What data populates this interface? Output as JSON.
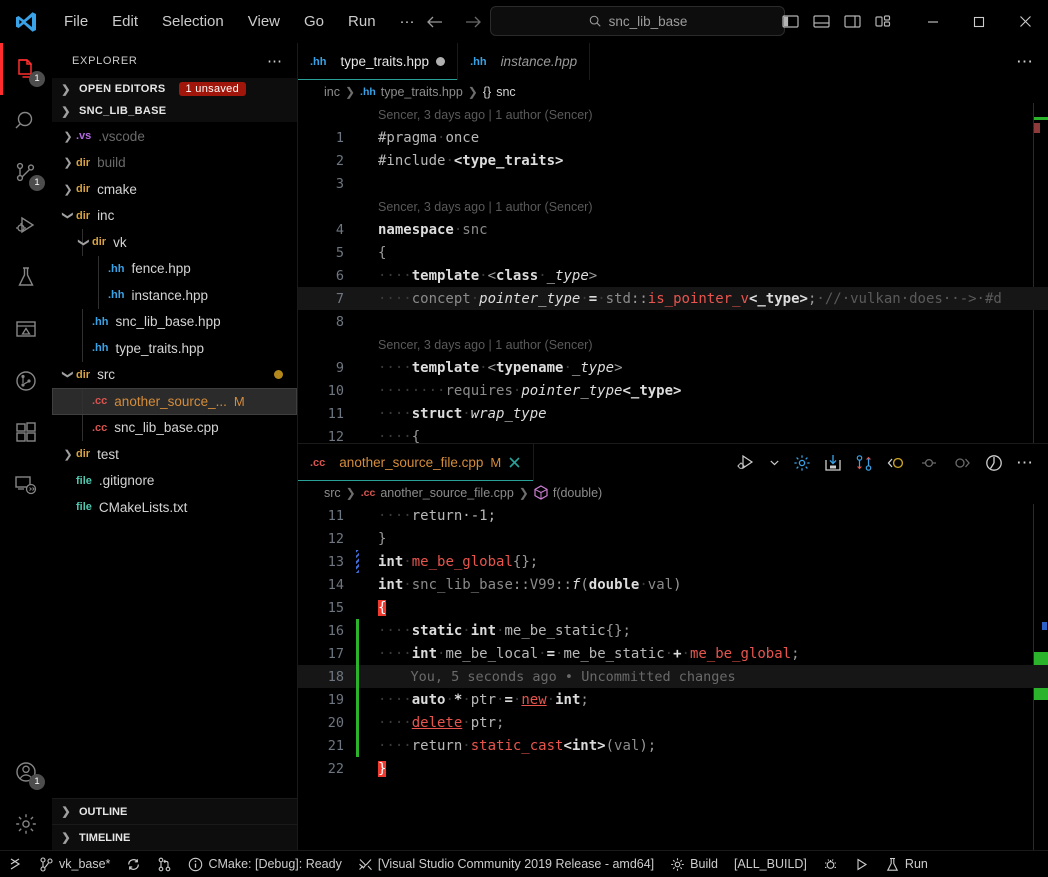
{
  "titlebar": {
    "logo": "vscode-logo-icon",
    "menus": [
      "File",
      "Edit",
      "Selection",
      "View",
      "Go",
      "Run",
      "···"
    ],
    "back_icon": "arrow-left-icon",
    "forward_icon": "arrow-right-icon",
    "search": {
      "icon": "search-icon",
      "value": "snc_lib_base",
      "placeholder": "Search"
    },
    "layout_icons": [
      "toggle-primary-sidebar-icon",
      "toggle-panel-icon",
      "toggle-secondary-sidebar-icon",
      "customize-layout-icon"
    ],
    "window_controls": [
      "minimize-icon",
      "maximize-icon",
      "close-icon"
    ]
  },
  "activitybar": {
    "items": [
      {
        "name": "explorer",
        "icon": "files-icon",
        "badge": "1",
        "active": true
      },
      {
        "name": "search",
        "icon": "search-icon",
        "badge": "",
        "active": false
      },
      {
        "name": "source-control",
        "icon": "source-control-icon",
        "badge": "1",
        "active": false
      },
      {
        "name": "run-and-debug",
        "icon": "run-debug-icon",
        "badge": "",
        "active": false
      },
      {
        "name": "testing",
        "icon": "beaker-icon",
        "badge": "",
        "active": false
      },
      {
        "name": "cmake",
        "icon": "cmake-icon",
        "badge": "",
        "active": false
      },
      {
        "name": "git-graph",
        "icon": "git-graph-icon",
        "badge": "",
        "active": false
      },
      {
        "name": "extensions",
        "icon": "extensions-icon",
        "badge": "",
        "active": false
      },
      {
        "name": "remote-explorer",
        "icon": "remote-icon",
        "badge": "",
        "active": false
      }
    ],
    "bottom_items": [
      {
        "name": "accounts",
        "icon": "account-icon",
        "badge": "1"
      },
      {
        "name": "manage-settings",
        "icon": "gear-icon",
        "badge": ""
      }
    ]
  },
  "sidebar": {
    "title": "EXPLORER",
    "more_icon": "more-actions-icon",
    "open_editors": {
      "label": "OPEN EDITORS",
      "badge": "1 unsaved",
      "expanded": false
    },
    "workspace": {
      "label": "SNC_LIB_BASE",
      "expanded": true
    },
    "tree": [
      {
        "indent": 1,
        "arrow": "collapsed",
        "icon": ".vs",
        "icon_color": "#b36ae2",
        "label": ".vscode",
        "label_color": "#6a6a6a",
        "modified": "",
        "dot": false
      },
      {
        "indent": 1,
        "arrow": "collapsed",
        "icon": "dir",
        "icon_color": "#d9a441",
        "label": "build",
        "label_color": "#6a6a6a",
        "modified": "",
        "dot": false
      },
      {
        "indent": 1,
        "arrow": "collapsed",
        "icon": "dir",
        "icon_color": "#d9a441",
        "label": "cmake",
        "label_color": "#d4d4d4",
        "modified": "",
        "dot": false
      },
      {
        "indent": 1,
        "arrow": "expanded",
        "icon": "dir",
        "icon_color": "#d9a441",
        "label": "inc",
        "label_color": "#d4d4d4",
        "modified": "",
        "dot": false
      },
      {
        "indent": 2,
        "arrow": "expanded",
        "icon": "dir",
        "icon_color": "#d9a441",
        "label": "vk",
        "label_color": "#d4d4d4",
        "modified": "",
        "dot": false
      },
      {
        "indent": 3,
        "arrow": "none",
        "icon": ".hh",
        "icon_color": "#3aa3e8",
        "label": "fence.hpp",
        "label_color": "#d4d4d4",
        "modified": "",
        "dot": false
      },
      {
        "indent": 3,
        "arrow": "none",
        "icon": ".hh",
        "icon_color": "#3aa3e8",
        "label": "instance.hpp",
        "label_color": "#d4d4d4",
        "modified": "",
        "dot": false
      },
      {
        "indent": 2,
        "arrow": "none",
        "icon": ".hh",
        "icon_color": "#3aa3e8",
        "label": "snc_lib_base.hpp",
        "label_color": "#d4d4d4",
        "modified": "",
        "dot": false
      },
      {
        "indent": 2,
        "arrow": "none",
        "icon": ".hh",
        "icon_color": "#3aa3e8",
        "label": "type_traits.hpp",
        "label_color": "#d4d4d4",
        "modified": "",
        "dot": false
      },
      {
        "indent": 1,
        "arrow": "expanded",
        "icon": "dir",
        "icon_color": "#d9a441",
        "label": "src",
        "label_color": "#d4d4d4",
        "modified": "",
        "dot": true
      },
      {
        "indent": 2,
        "arrow": "none",
        "icon": ".cc",
        "icon_color": "#d9534f",
        "label": "another_source_...",
        "label_color": "#d48c3a",
        "modified": "M",
        "dot": false,
        "selected": true
      },
      {
        "indent": 2,
        "arrow": "none",
        "icon": ".cc",
        "icon_color": "#d9534f",
        "label": "snc_lib_base.cpp",
        "label_color": "#d4d4d4",
        "modified": "",
        "dot": false
      },
      {
        "indent": 1,
        "arrow": "collapsed",
        "icon": "dir",
        "icon_color": "#d9a441",
        "label": "test",
        "label_color": "#d4d4d4",
        "modified": "",
        "dot": false
      },
      {
        "indent": 1,
        "arrow": "none",
        "icon": "file",
        "icon_color": "#4ec9b0",
        "label": ".gitignore",
        "label_color": "#d4d4d4",
        "modified": "",
        "dot": false
      },
      {
        "indent": 1,
        "arrow": "none",
        "icon": "file",
        "icon_color": "#4ec9b0",
        "label": "CMakeLists.txt",
        "label_color": "#d4d4d4",
        "modified": "",
        "dot": false
      }
    ],
    "outline": "OUTLINE",
    "timeline": "TIMELINE"
  },
  "editor_top": {
    "tabs": [
      {
        "icon": ".hh",
        "icon_color": "#3aa3e8",
        "label": "type_traits.hpp",
        "active": true,
        "dirty": true,
        "italic": false
      },
      {
        "icon": ".hh",
        "icon_color": "#3aa3e8",
        "label": "instance.hpp",
        "active": false,
        "dirty": false,
        "italic": true
      }
    ],
    "more_icon": "editor-actions-more-icon",
    "breadcrumb": [
      {
        "text": "inc",
        "kind": "folder"
      },
      {
        "text": ".hh",
        "kind": "hh-badge"
      },
      {
        "text": "type_traits.hpp",
        "kind": "file"
      },
      {
        "text": "{}",
        "kind": "namespace-icon"
      },
      {
        "text": "snc",
        "kind": "symbol"
      }
    ],
    "lines": [
      {
        "no": "",
        "kind": "blame",
        "text": "Sencer, 3 days ago | 1 author (Sencer)"
      },
      {
        "no": "1",
        "kind": "code",
        "tokens": [
          {
            "t": "#pragma",
            "c": "plain"
          },
          {
            "t": "·",
            "c": "ind"
          },
          {
            "t": "once",
            "c": "plain"
          }
        ]
      },
      {
        "no": "2",
        "kind": "code",
        "tokens": [
          {
            "t": "#include",
            "c": "plain"
          },
          {
            "t": "·",
            "c": "ind"
          },
          {
            "t": "<type_traits>",
            "c": "kw"
          }
        ]
      },
      {
        "no": "3",
        "kind": "code",
        "tokens": []
      },
      {
        "no": "",
        "kind": "blame",
        "text": "Sencer, 3 days ago | 1 author (Sencer)"
      },
      {
        "no": "4",
        "kind": "code",
        "tokens": [
          {
            "t": "namespace",
            "c": "kw"
          },
          {
            "t": "·",
            "c": "ind"
          },
          {
            "t": "snc",
            "c": "dim"
          }
        ]
      },
      {
        "no": "5",
        "kind": "code",
        "tokens": [
          {
            "t": "{",
            "c": "punct"
          }
        ]
      },
      {
        "no": "6",
        "kind": "code",
        "tokens": [
          {
            "t": "····",
            "c": "ind"
          },
          {
            "t": "template",
            "c": "kw"
          },
          {
            "t": "·",
            "c": "ind"
          },
          {
            "t": "<",
            "c": "punct"
          },
          {
            "t": "class",
            "c": "kw"
          },
          {
            "t": "·",
            "c": "ind"
          },
          {
            "t": "_type",
            "c": "type-i"
          },
          {
            "t": ">",
            "c": "punct"
          }
        ]
      },
      {
        "no": "7",
        "kind": "code",
        "highlight": true,
        "tokens": [
          {
            "t": "····",
            "c": "ind"
          },
          {
            "t": "concept",
            "c": "dim"
          },
          {
            "t": "·",
            "c": "ind"
          },
          {
            "t": "pointer_type",
            "c": "type-i"
          },
          {
            "t": "·",
            "c": "ind"
          },
          {
            "t": "=",
            "c": "kw"
          },
          {
            "t": "·",
            "c": "ind"
          },
          {
            "t": "std",
            "c": "dim"
          },
          {
            "t": "::",
            "c": "punct"
          },
          {
            "t": "is_pointer_v",
            "c": "id-red"
          },
          {
            "t": "<_type>",
            "c": "kw"
          },
          {
            "t": ";",
            "c": "punct"
          },
          {
            "t": "·//·vulkan·does··->·#d",
            "c": "comment"
          }
        ]
      },
      {
        "no": "8",
        "kind": "code",
        "tokens": []
      },
      {
        "no": "",
        "kind": "blame",
        "text": "Sencer, 3 days ago | 1 author (Sencer)"
      },
      {
        "no": "9",
        "kind": "code",
        "tokens": [
          {
            "t": "····",
            "c": "ind"
          },
          {
            "t": "template",
            "c": "kw"
          },
          {
            "t": "·",
            "c": "ind"
          },
          {
            "t": "<",
            "c": "punct"
          },
          {
            "t": "typename",
            "c": "kw"
          },
          {
            "t": "·",
            "c": "ind"
          },
          {
            "t": "_type",
            "c": "type-i"
          },
          {
            "t": ">",
            "c": "punct"
          }
        ]
      },
      {
        "no": "10",
        "kind": "code",
        "tokens": [
          {
            "t": "········",
            "c": "ind"
          },
          {
            "t": "requires",
            "c": "dim"
          },
          {
            "t": "·",
            "c": "ind"
          },
          {
            "t": "pointer_type",
            "c": "type-i"
          },
          {
            "t": "<_type>",
            "c": "kw"
          }
        ]
      },
      {
        "no": "11",
        "kind": "code",
        "tokens": [
          {
            "t": "····",
            "c": "ind"
          },
          {
            "t": "struct",
            "c": "kw"
          },
          {
            "t": "·",
            "c": "ind"
          },
          {
            "t": "wrap_type",
            "c": "type-i"
          }
        ]
      },
      {
        "no": "12",
        "kind": "code",
        "tokens": [
          {
            "t": "····",
            "c": "ind"
          },
          {
            "t": "{",
            "c": "punct"
          }
        ]
      }
    ]
  },
  "editor_bottom": {
    "tabs": [
      {
        "icon": ".cc",
        "icon_color": "#d9534f",
        "label": "another_source_file.cpp",
        "modified": "M",
        "active": true,
        "close_icon": "close-icon"
      }
    ],
    "toolbar_icons": [
      "run-or-debug-icon",
      "chevron-down-icon",
      "cmake-settings-gear-icon",
      "save-all-icon",
      "compare-changes-icon",
      "git-previous-change-icon",
      "git-current-change-icon",
      "git-next-change-icon",
      "toggle-blame-icon",
      "editor-actions-more-icon"
    ],
    "breadcrumb": [
      {
        "text": "src",
        "kind": "folder"
      },
      {
        "text": ".cc",
        "kind": "cc-badge"
      },
      {
        "text": "another_source_file.cpp",
        "kind": "file"
      },
      {
        "text": "f(double)",
        "kind": "symbol-method"
      }
    ],
    "lines": [
      {
        "no": "11",
        "kind": "code",
        "clipped": true,
        "tokens": [
          {
            "t": "····",
            "c": "ind"
          },
          {
            "t": "return",
            "c": "plain"
          },
          {
            "t": "·-1;",
            "c": "plain"
          }
        ]
      },
      {
        "no": "12",
        "kind": "code",
        "tokens": [
          {
            "t": "}",
            "c": "punct"
          }
        ]
      },
      {
        "no": "13",
        "kind": "code",
        "gutter_mark": "blue",
        "tokens": [
          {
            "t": "int",
            "c": "kw"
          },
          {
            "t": "·",
            "c": "ind"
          },
          {
            "t": "me_be_global",
            "c": "id-red"
          },
          {
            "t": "{};",
            "c": "punct"
          }
        ]
      },
      {
        "no": "14",
        "kind": "code",
        "tokens": [
          {
            "t": "int",
            "c": "kw"
          },
          {
            "t": "·",
            "c": "ind"
          },
          {
            "t": "snc_lib_base",
            "c": "dim"
          },
          {
            "t": "::",
            "c": "punct"
          },
          {
            "t": "V99",
            "c": "dim"
          },
          {
            "t": "::",
            "c": "punct"
          },
          {
            "t": "f",
            "c": "type-i"
          },
          {
            "t": "(",
            "c": "punct"
          },
          {
            "t": "double",
            "c": "kw"
          },
          {
            "t": "·",
            "c": "ind"
          },
          {
            "t": "val",
            "c": "dim"
          },
          {
            "t": ")",
            "c": "punct"
          }
        ]
      },
      {
        "no": "15",
        "kind": "code",
        "tokens": [
          {
            "t": "{",
            "c": "err-brace"
          }
        ]
      },
      {
        "no": "16",
        "kind": "code",
        "gutter_mark": "green",
        "tokens": [
          {
            "t": "····",
            "c": "ind"
          },
          {
            "t": "static",
            "c": "kw"
          },
          {
            "t": "·",
            "c": "ind"
          },
          {
            "t": "int",
            "c": "kw"
          },
          {
            "t": "·",
            "c": "ind"
          },
          {
            "t": "me_be_static",
            "c": "plain"
          },
          {
            "t": "{};",
            "c": "punct"
          }
        ]
      },
      {
        "no": "17",
        "kind": "code",
        "gutter_mark": "green",
        "tokens": [
          {
            "t": "····",
            "c": "ind"
          },
          {
            "t": "int",
            "c": "kw"
          },
          {
            "t": "·",
            "c": "ind"
          },
          {
            "t": "me_be_local",
            "c": "plain"
          },
          {
            "t": "·",
            "c": "ind"
          },
          {
            "t": "=",
            "c": "kw"
          },
          {
            "t": "·",
            "c": "ind"
          },
          {
            "t": "me_be_static",
            "c": "plain"
          },
          {
            "t": "·",
            "c": "ind"
          },
          {
            "t": "+",
            "c": "kw"
          },
          {
            "t": "·",
            "c": "ind"
          },
          {
            "t": "me_be_global",
            "c": "id-red"
          },
          {
            "t": ";",
            "c": "punct"
          }
        ]
      },
      {
        "no": "18",
        "kind": "blame-inline",
        "gutter_mark": "green",
        "text": "You, 5 seconds ago • Uncommitted changes"
      },
      {
        "no": "19",
        "kind": "code",
        "gutter_mark": "green",
        "tokens": [
          {
            "t": "····",
            "c": "ind"
          },
          {
            "t": "auto",
            "c": "kw"
          },
          {
            "t": "·",
            "c": "ind"
          },
          {
            "t": "*",
            "c": "kw"
          },
          {
            "t": "·",
            "c": "ind"
          },
          {
            "t": "ptr",
            "c": "plain"
          },
          {
            "t": "·",
            "c": "ind"
          },
          {
            "t": "=",
            "c": "kw"
          },
          {
            "t": "·",
            "c": "ind"
          },
          {
            "t": "new",
            "c": "id-redu"
          },
          {
            "t": "·",
            "c": "ind"
          },
          {
            "t": "int",
            "c": "kw"
          },
          {
            "t": ";",
            "c": "punct"
          }
        ]
      },
      {
        "no": "20",
        "kind": "code",
        "gutter_mark": "green",
        "tokens": [
          {
            "t": "····",
            "c": "ind"
          },
          {
            "t": "delete",
            "c": "id-redu"
          },
          {
            "t": "·",
            "c": "ind"
          },
          {
            "t": "ptr",
            "c": "plain"
          },
          {
            "t": ";",
            "c": "punct"
          }
        ]
      },
      {
        "no": "21",
        "kind": "code",
        "gutter_mark": "green",
        "tokens": [
          {
            "t": "····",
            "c": "ind"
          },
          {
            "t": "return",
            "c": "plain"
          },
          {
            "t": "·",
            "c": "ind"
          },
          {
            "t": "static_cast",
            "c": "id-red"
          },
          {
            "t": "<int>",
            "c": "kw"
          },
          {
            "t": "(",
            "c": "punct"
          },
          {
            "t": "val",
            "c": "dim"
          },
          {
            "t": ");",
            "c": "punct"
          }
        ]
      },
      {
        "no": "22",
        "kind": "code",
        "tokens": [
          {
            "t": "}",
            "c": "err-brace"
          }
        ]
      }
    ]
  },
  "statusbar": {
    "left": [
      {
        "icon": "remote-indicator-icon",
        "text": ""
      },
      {
        "icon": "source-control-branch-icon",
        "text": "vk_base*"
      },
      {
        "icon": "sync-icon",
        "text": ""
      },
      {
        "icon": "pull-request-icon",
        "text": ""
      },
      {
        "icon": "info-icon",
        "text": "CMake: [Debug]: Ready"
      },
      {
        "icon": "tools-icon",
        "text": "[Visual Studio Community 2019 Release - amd64]"
      },
      {
        "icon": "gear-icon",
        "text": "Build"
      },
      {
        "icon": "",
        "text": "[ALL_BUILD]"
      },
      {
        "icon": "bug-icon",
        "text": ""
      },
      {
        "icon": "play-icon",
        "text": ""
      },
      {
        "icon": "beaker-icon",
        "text": "Run"
      }
    ]
  }
}
